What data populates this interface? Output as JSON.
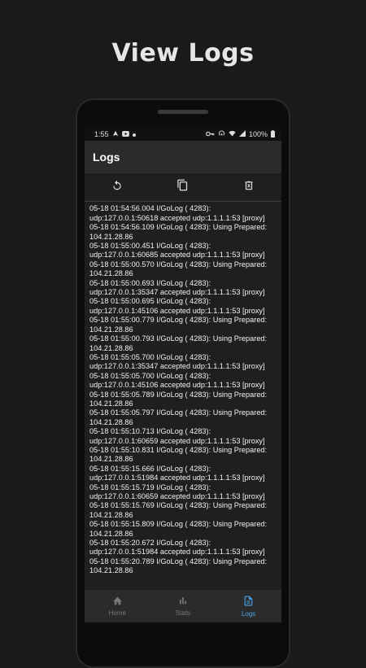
{
  "promo": {
    "title": "View Logs"
  },
  "status_bar": {
    "time": "1:55",
    "battery": "100%"
  },
  "app_bar": {
    "title": "Logs"
  },
  "toolbar": {
    "icons": [
      "refresh-icon",
      "copy-icon",
      "delete-icon"
    ]
  },
  "logs": [
    "104.21.28.86",
    "05-18 01:54:56.004 I/GoLog   ( 4283):",
    "udp:127.0.0.1:50618 accepted udp:1.1.1.1:53 [proxy]",
    "05-18 01:54:56.109 I/GoLog   ( 4283): Using Prepared:",
    "104.21.28.86",
    "05-18 01:55:00.451 I/GoLog   ( 4283):",
    "udp:127.0.0.1:60685 accepted udp:1.1.1.1:53 [proxy]",
    "05-18 01:55:00.570 I/GoLog   ( 4283): Using Prepared:",
    "104.21.28.86",
    "05-18 01:55:00.693 I/GoLog   ( 4283):",
    "udp:127.0.0.1:35347 accepted udp:1.1.1.1:53 [proxy]",
    "05-18 01:55:00.695 I/GoLog   ( 4283):",
    "udp:127.0.0.1:45106 accepted udp:1.1.1.1:53 [proxy]",
    "05-18 01:55:00.779 I/GoLog   ( 4283): Using Prepared:",
    "104.21.28.86",
    "05-18 01:55:00.793 I/GoLog   ( 4283): Using Prepared:",
    "104.21.28.86",
    "05-18 01:55:05.700 I/GoLog   ( 4283):",
    "udp:127.0.0.1:35347 accepted udp:1.1.1.1:53 [proxy]",
    "05-18 01:55:05.700 I/GoLog   ( 4283):",
    "udp:127.0.0.1:45106 accepted udp:1.1.1.1:53 [proxy]",
    "05-18 01:55:05.789 I/GoLog   ( 4283): Using Prepared:",
    "104.21.28.86",
    "05-18 01:55:05.797 I/GoLog   ( 4283): Using Prepared:",
    "104.21.28.86",
    "05-18 01:55:10.713 I/GoLog   ( 4283):",
    "udp:127.0.0.1:60659 accepted udp:1.1.1.1:53 [proxy]",
    "05-18 01:55:10.831 I/GoLog   ( 4283): Using Prepared:",
    "104.21.28.86",
    "05-18 01:55:15.666 I/GoLog   ( 4283):",
    "udp:127.0.0.1:51984 accepted udp:1.1.1.1:53 [proxy]",
    "05-18 01:55:15.719 I/GoLog   ( 4283):",
    "udp:127.0.0.1:60659 accepted udp:1.1.1.1:53 [proxy]",
    "05-18 01:55:15.769 I/GoLog   ( 4283): Using Prepared:",
    "104.21.28.86",
    "05-18 01:55:15.809 I/GoLog   ( 4283): Using Prepared:",
    "104.21.28.86",
    "05-18 01:55:20.672 I/GoLog   ( 4283):",
    "udp:127.0.0.1:51984 accepted udp:1.1.1.1:53 [proxy]",
    "05-18 01:55:20.789 I/GoLog   ( 4283): Using Prepared:",
    "104.21.28.86"
  ],
  "bottom_nav": {
    "items": [
      {
        "label": "Home",
        "icon": "home-icon",
        "active": false
      },
      {
        "label": "Stats",
        "icon": "bar-chart-icon",
        "active": false
      },
      {
        "label": "Logs",
        "icon": "document-icon",
        "active": true
      }
    ]
  },
  "colors": {
    "accent": "#4aa3e8",
    "background": "#1f1f1f",
    "app_bar": "#2b2b2b"
  }
}
